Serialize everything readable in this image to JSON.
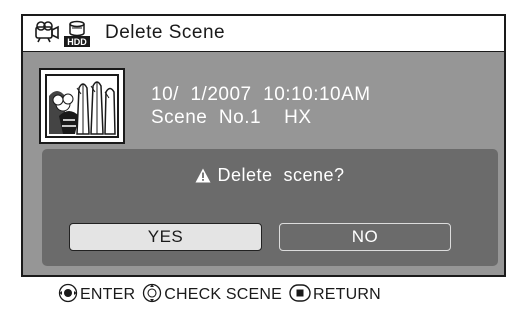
{
  "header": {
    "title": "Delete  Scene",
    "icons": [
      "camcorder-icon",
      "hdd-icon"
    ],
    "hdd_label": "HDD"
  },
  "scene": {
    "datetime": "10/  1/2007  10:10:10AM",
    "number_line": "Scene  No.1    HX",
    "thumbnail": "scene-thumbnail"
  },
  "dialog": {
    "question": "Delete  scene?",
    "warning_icon": "warning-icon",
    "yes_label": "YES",
    "no_label": "NO"
  },
  "footer": {
    "enter_label": "ENTER",
    "check_label": "CHECK  SCENE",
    "return_label": "RETURN"
  },
  "colors": {
    "screen_bg": "#969696",
    "dialog_bg": "#6b6b6b",
    "selected_button": "#e4e4e4"
  }
}
